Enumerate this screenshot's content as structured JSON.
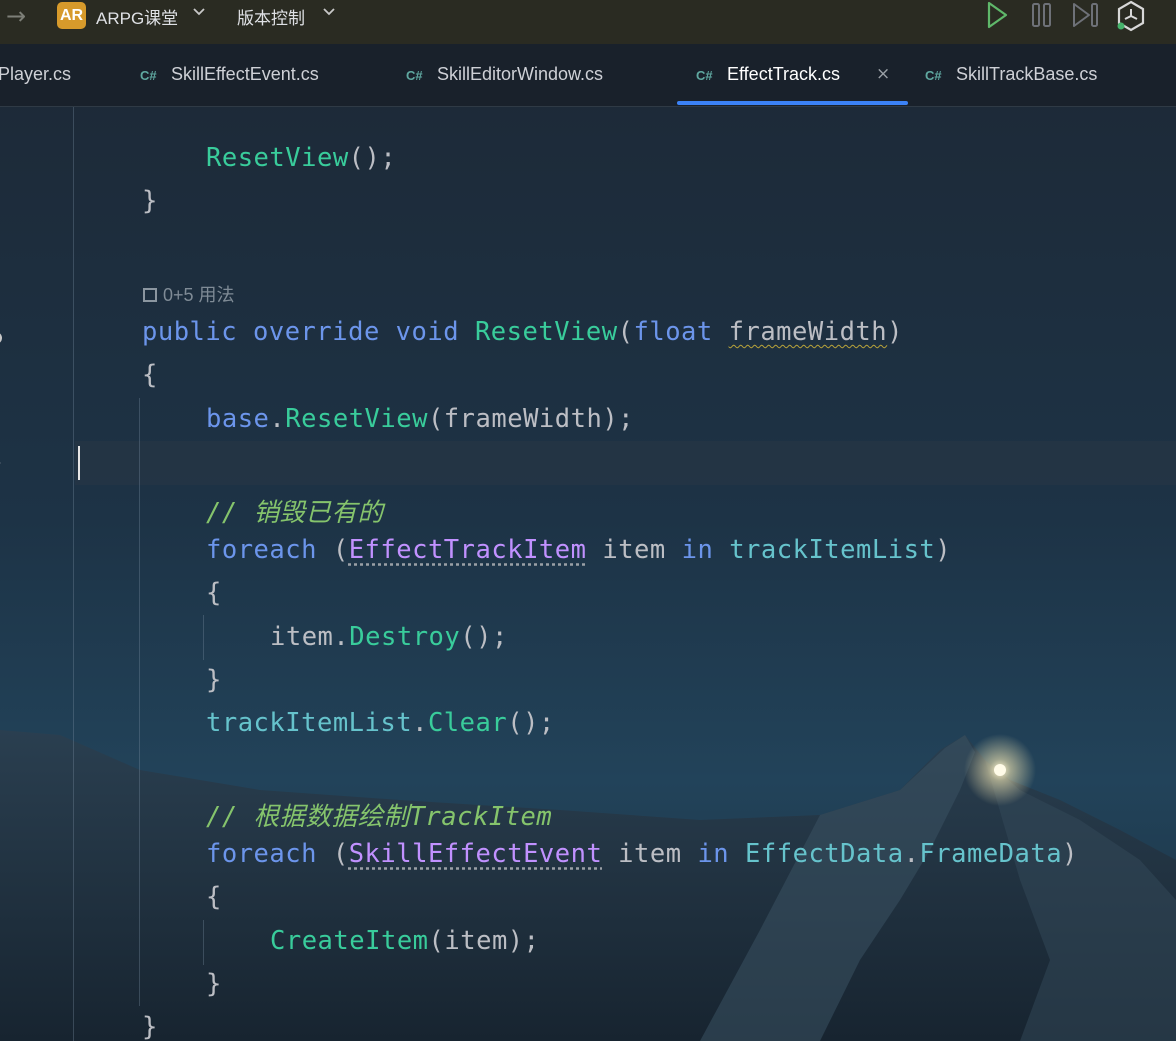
{
  "titlebar": {
    "back_arrow": "→",
    "project_badge": "AR",
    "project_name": "ARPG课堂",
    "vcs_label": "版本控制",
    "run_icon": "run-icon",
    "pause_icon": "pause-icon",
    "step_icon": "step-icon",
    "unity_icon": "unity-icon"
  },
  "tabs": [
    {
      "label": "Player.cs",
      "active": false
    },
    {
      "cs": "C#",
      "label": "SkillEffectEvent.cs",
      "active": false
    },
    {
      "cs": "C#",
      "label": "SkillEditorWindow.cs",
      "active": false
    },
    {
      "cs": "C#",
      "label": "EffectTrack.cs",
      "active": true,
      "close": "×"
    },
    {
      "cs": "C#",
      "label": "SkillTrackBase.cs",
      "active": false
    }
  ],
  "editor": {
    "usage_hint": "0+5 用法",
    "lines": {
      "l1_fn": "ResetView",
      "l1_rest": "();",
      "l2": "}",
      "l4_kw1": "public",
      "l4_kw2": "override",
      "l4_kw3": "void",
      "l4_fn": "ResetView",
      "l4_p1": "(",
      "l4_kw4": "float",
      "l4_param": "frameWidth",
      "l4_p2": ")",
      "l5": "{",
      "l6_kw": "base",
      "l6_dot": ".",
      "l6_fn": "ResetView",
      "l6_rest": "(frameWidth);",
      "c1": "// 销毁已有的",
      "f1_kw": "foreach",
      "f1_p1": " (",
      "f1_type": "EffectTrackItem",
      "f1_item": " item ",
      "f1_in": "in",
      "f1_sp": " ",
      "f1_field": "trackItemList",
      "f1_p2": ")",
      "b1": "{",
      "d_item": "item",
      "d_dot": ".",
      "d_fn": "Destroy",
      "d_rest": "();",
      "b2": "}",
      "cl_field": "trackItemList",
      "cl_dot": ".",
      "cl_fn": "Clear",
      "cl_rest": "();",
      "c2": "// 根据数据绘制TrackItem",
      "f2_kw": "foreach",
      "f2_p1": " (",
      "f2_type": "SkillEffectEvent",
      "f2_item": " item ",
      "f2_in": "in",
      "f2_sp": " ",
      "f2_field1": "EffectData",
      "f2_dot": ".",
      "f2_field2": "FrameData",
      "f2_p2": ")",
      "b3": "{",
      "ci_fn": "CreateItem",
      "ci_rest": "(item);",
      "b4": "}",
      "b5": "}"
    }
  }
}
